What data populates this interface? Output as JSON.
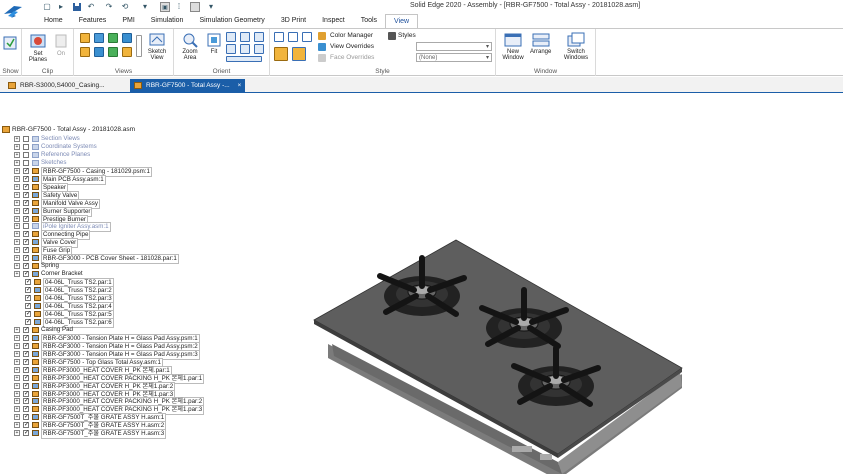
{
  "window": {
    "title": "Solid Edge 2020 - Assembly - [RBR-GF7500 - Total Assy - 20181028.asm]"
  },
  "quick_access": [
    "▢",
    "▸",
    "↶",
    "↷",
    "⟲",
    "▾"
  ],
  "tabs": [
    "Home",
    "Features",
    "PMI",
    "Simulation",
    "Simulation Geometry",
    "3D Print",
    "Inspect",
    "Tools",
    "View"
  ],
  "active_tab": "View",
  "ribbon": {
    "show": {
      "group_label": "Show"
    },
    "clip": {
      "set_planes": "Set Planes",
      "on": "On",
      "group_label": "Clip"
    },
    "views": {
      "group_label": "Views",
      "sketch_view": "Sketch View"
    },
    "orient": {
      "zoom_area": "Zoom Area",
      "fit": "Fit",
      "group_label": "Orient"
    },
    "style": {
      "color_manager": "Color Manager",
      "styles": "Styles",
      "view_overrides": "View Overrides",
      "face_overrides": "Face Overrides",
      "face_override_value": "(None)",
      "group_label": "Style"
    },
    "window": {
      "new_window": "New Window",
      "arrange": "Arrange",
      "switch_windows": "Switch Windows",
      "group_label": "Window"
    }
  },
  "doc_tabs": [
    {
      "label": "RBR-S3000,S4000_Casing...",
      "active": false
    },
    {
      "label": "RBR-GF7500 - Total Assy -...",
      "active": true
    }
  ],
  "tree": {
    "root": "RBR-GF7500 - Total Assy - 20181028.asm",
    "items": [
      {
        "label": "Section Views",
        "muted": true,
        "checked": false
      },
      {
        "label": "Coordinate Systems",
        "muted": true,
        "checked": false
      },
      {
        "label": "Reference Planes",
        "muted": true,
        "checked": false
      },
      {
        "label": "Sketches",
        "muted": true,
        "checked": false
      },
      {
        "label": "RBR-GF7500 - Casing - 181029.psm:1",
        "checked": true,
        "hl": true
      },
      {
        "label": "Main PCB Assy.asm:1",
        "checked": true,
        "hl": true
      },
      {
        "label": "Speaker",
        "checked": true,
        "hl": true
      },
      {
        "label": "Safety Valve",
        "checked": true,
        "hl": true
      },
      {
        "label": "Manifold Valve Assy",
        "checked": true,
        "hl": true
      },
      {
        "label": "Burner Supporter",
        "checked": true,
        "hl": true
      },
      {
        "label": "Prestige Burner",
        "checked": true,
        "hl": true
      },
      {
        "label": "iPole Igniter Assy.asm:1",
        "muted": true,
        "checked": false,
        "hl": true
      },
      {
        "label": "Connecting Pipe",
        "checked": true,
        "hl": true
      },
      {
        "label": "Valve Cover",
        "checked": true,
        "hl": true
      },
      {
        "label": "Fuse Grip",
        "checked": true,
        "hl": true
      },
      {
        "label": "RBR-GF3000 - PCB Cover Sheet - 181028.par:1",
        "checked": true,
        "hl": true
      },
      {
        "label": "Spring",
        "checked": true
      },
      {
        "label": "Corner Bracket",
        "checked": true
      },
      {
        "label": "04-06L_Truss TS2.par:1",
        "checked": true,
        "hl": true,
        "level": 1
      },
      {
        "label": "04-06L_Truss TS2.par:2",
        "checked": true,
        "hl": true,
        "level": 1
      },
      {
        "label": "04-06L_Truss TS2.par:3",
        "checked": true,
        "hl": true,
        "level": 1
      },
      {
        "label": "04-06L_Truss TS2.par:4",
        "checked": true,
        "hl": true,
        "level": 1
      },
      {
        "label": "04-06L_Truss TS2.par:5",
        "checked": true,
        "hl": true,
        "level": 1
      },
      {
        "label": "04-06L_Truss TS2.par:6",
        "checked": true,
        "hl": true,
        "level": 1
      },
      {
        "label": "Casing Pad",
        "checked": true
      },
      {
        "label": "RBR-GF3000 - Tension Plate H = Glass Pad Assy.psm:1",
        "checked": true,
        "hl": true
      },
      {
        "label": "RBR-GF3000 - Tension Plate H = Glass Pad Assy.psm:2",
        "checked": true,
        "hl": true
      },
      {
        "label": "RBR-GF3000 - Tension Plate H = Glass Pad Assy.psm:3",
        "checked": true,
        "hl": true
      },
      {
        "label": "RBR-GF7500 - Top Glass Total Assy.asm:1",
        "checked": true,
        "hl": true
      },
      {
        "label": "RBR-PF3000_HEAT COVER H_PK 본체.par:1",
        "checked": true,
        "hl": true
      },
      {
        "label": "RBR-PF3000_HEAT COVER PACKING H_PK 본체1.par:1",
        "checked": true,
        "hl": true
      },
      {
        "label": "RBR-PF3000_HEAT COVER H_PK 본체1.par:2",
        "checked": true,
        "hl": true
      },
      {
        "label": "RBR-PF3000_HEAT COVER H_PK 본체1.par:3",
        "checked": true,
        "hl": true
      },
      {
        "label": "RBR-PF3000_HEAT COVER PACKING H_PK 본체1.par:2",
        "checked": true,
        "hl": true
      },
      {
        "label": "RBR-PF3000_HEAT COVER PACKING H_PK 본체1.par:3",
        "checked": true,
        "hl": true
      },
      {
        "label": "RBR-GF7500T_주물 GRATE ASSY H.asm:1",
        "checked": true,
        "hl": true
      },
      {
        "label": "RBR-GF7500T_주물 GRATE ASSY H.asm:2",
        "checked": true,
        "hl": true
      },
      {
        "label": "RBR-GF7500T_주물 GRATE ASSY H.asm:3",
        "checked": true,
        "hl": true
      }
    ]
  },
  "colors": {
    "accent": "#1b5ea8",
    "tab_active_text": "#1e4f9a",
    "glass_top": "#5d5d5d",
    "casing": "#8a8a8a",
    "burner": "#1a1a1a"
  }
}
